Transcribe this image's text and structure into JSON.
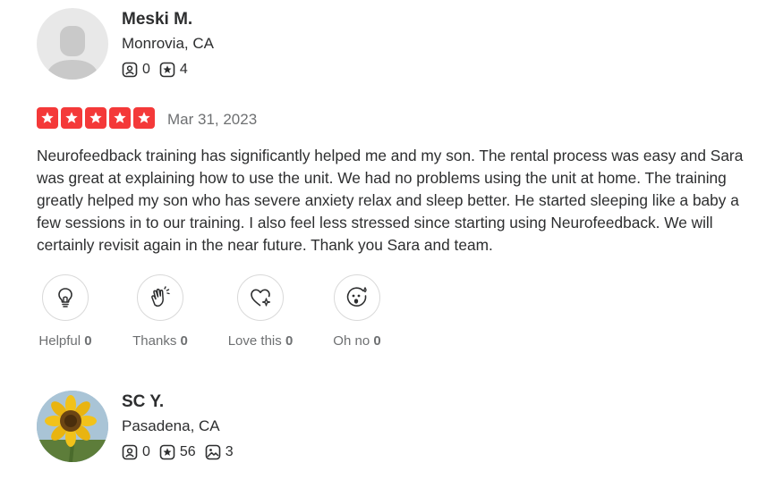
{
  "reviews": [
    {
      "user": {
        "name": "Meski M.",
        "location": "Monrovia, CA",
        "friends": "0",
        "reviews": "4"
      },
      "rating": 5,
      "date": "Mar 31, 2023",
      "text": "Neurofeedback training has significantly helped me and my son. The rental process was easy and Sara was great at explaining how to use the unit. We had no problems using the unit at home. The training greatly helped my son who has severe anxiety relax and sleep better. He started sleeping like a baby a few sessions in to our training. I also feel less stressed since starting using Neurofeedback. We will certainly revisit again in the near future. Thank you Sara and team.",
      "reactions": [
        {
          "label": "Helpful",
          "count": "0",
          "icon": "lightbulb-icon"
        },
        {
          "label": "Thanks",
          "count": "0",
          "icon": "clapping-hands-icon"
        },
        {
          "label": "Love this",
          "count": "0",
          "icon": "heart-sparkle-icon"
        },
        {
          "label": "Oh no",
          "count": "0",
          "icon": "surprised-face-icon"
        }
      ]
    },
    {
      "user": {
        "name": "SC Y.",
        "location": "Pasadena, CA",
        "friends": "0",
        "reviews": "56",
        "photos": "3"
      }
    }
  ],
  "colors": {
    "star_red": "#f43939",
    "text": "#2d2e2f",
    "muted": "#6e7072"
  }
}
